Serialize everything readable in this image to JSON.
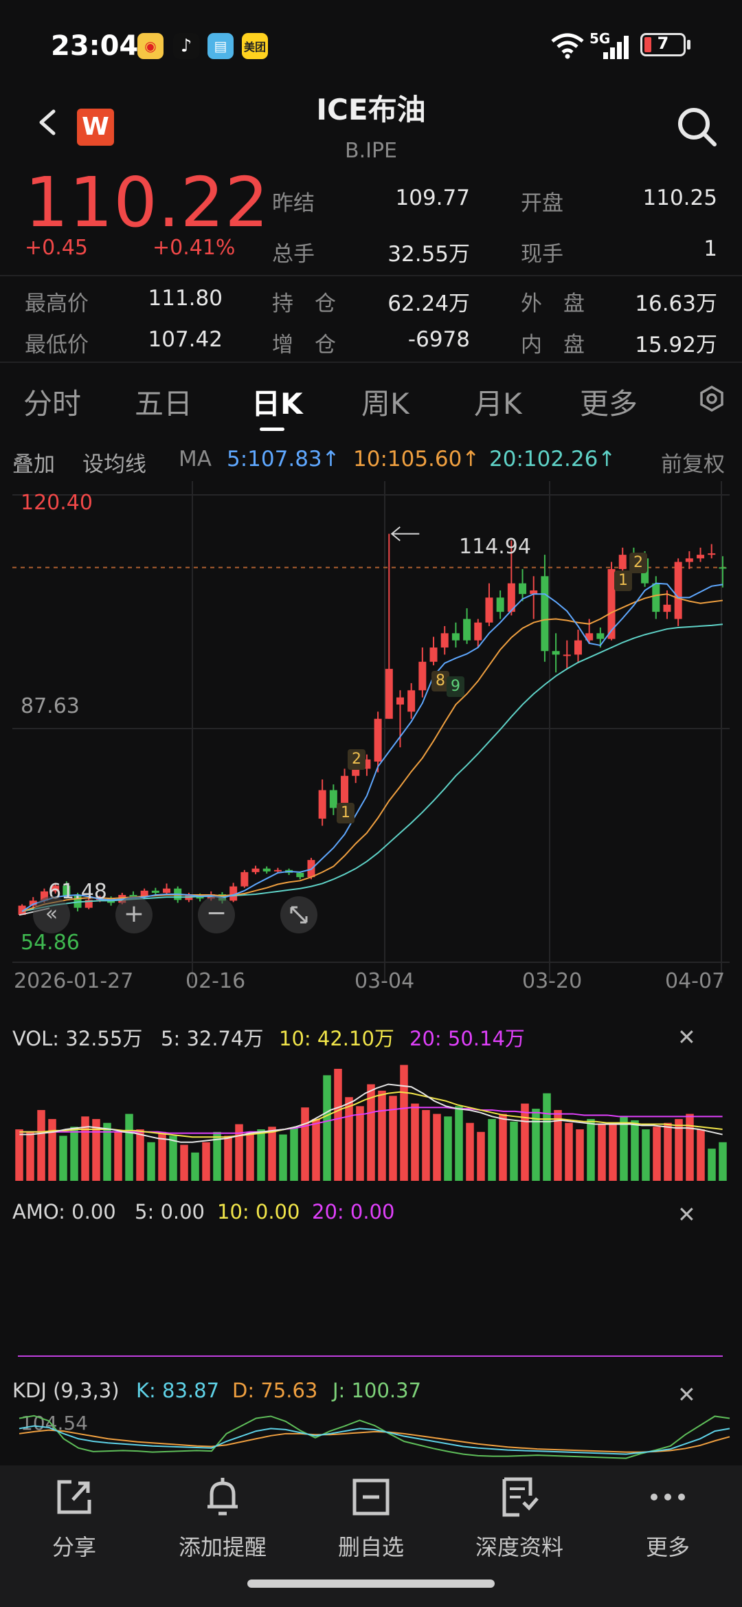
{
  "status": {
    "time": "23:04",
    "battery": "7",
    "network": "5G",
    "apps": [
      "weibo-icon",
      "tiktok-icon",
      "book-icon",
      "meituan-icon"
    ],
    "meituan_label": "美团"
  },
  "header": {
    "title": "ICE布油",
    "code": "B.IPE",
    "logo_letter": "W"
  },
  "quote": {
    "price": "110.22",
    "change": "+0.45",
    "change_pct": "+0.41%",
    "fields": [
      {
        "label": "昨结",
        "value": "109.77"
      },
      {
        "label": "开盘",
        "value": "110.25"
      },
      {
        "label": "总手",
        "value": "32.55万"
      },
      {
        "label": "现手",
        "value": "1"
      },
      {
        "label": "最高价",
        "value": "111.80"
      },
      {
        "label": "持　仓",
        "value": "62.24万"
      },
      {
        "label": "外　盘",
        "value": "16.63万"
      },
      {
        "label": "最低价",
        "value": "107.42"
      },
      {
        "label": "增　仓",
        "value": "-6978"
      },
      {
        "label": "内　盘",
        "value": "15.92万"
      }
    ]
  },
  "tabs": [
    {
      "label": "分时"
    },
    {
      "label": "五日"
    },
    {
      "label": "日K"
    },
    {
      "label": "周K"
    },
    {
      "label": "月K"
    },
    {
      "label": "更多"
    }
  ],
  "active_tab": "日K",
  "ma_row": {
    "overlay": "叠加",
    "set_ma": "设均线",
    "ma": "MA",
    "ma5": "5:107.83↑",
    "ma10": "10:105.60↑",
    "ma20": "20:102.26↑",
    "adjust": "前复权"
  },
  "colors": {
    "up": "#f04848",
    "down": "#3fb950",
    "ma5": "#5fa8ff",
    "ma10": "#f0a040",
    "ma20": "#5fd3c8",
    "yellow": "#f2e64a",
    "magenta": "#e040fb"
  },
  "chart_data": [
    {
      "type": "candlestick",
      "title": "",
      "y_labels": [
        "120.40",
        "87.63",
        "54.86"
      ],
      "ylim": [
        54.86,
        120.4
      ],
      "x_ticks": [
        "2026-01-27",
        "02-16",
        "03-04",
        "03-20",
        "04-07"
      ],
      "annotations": {
        "high": "114.94",
        "low": "61.48",
        "markers": [
          "1",
          "2",
          "8",
          "9",
          "1",
          "2"
        ]
      },
      "candles": [
        {
          "o": 61.5,
          "c": 62.8,
          "h": 63.0,
          "l": 61.5
        },
        {
          "o": 62.8,
          "c": 63.5,
          "h": 64.0,
          "l": 62.3
        },
        {
          "o": 63.5,
          "c": 64.8,
          "h": 65.2,
          "l": 63.2
        },
        {
          "o": 64.8,
          "c": 65.6,
          "h": 66.0,
          "l": 64.5
        },
        {
          "o": 65.6,
          "c": 64.2,
          "h": 66.2,
          "l": 63.8
        },
        {
          "o": 64.2,
          "c": 62.5,
          "h": 64.6,
          "l": 62.0
        },
        {
          "o": 62.5,
          "c": 63.6,
          "h": 64.0,
          "l": 62.3
        },
        {
          "o": 63.6,
          "c": 63.8,
          "h": 64.2,
          "l": 63.3
        },
        {
          "o": 63.8,
          "c": 63.2,
          "h": 64.1,
          "l": 62.8
        },
        {
          "o": 63.2,
          "c": 64.3,
          "h": 64.6,
          "l": 63.0
        },
        {
          "o": 64.3,
          "c": 64.0,
          "h": 64.8,
          "l": 63.7
        },
        {
          "o": 64.0,
          "c": 64.9,
          "h": 65.2,
          "l": 63.8
        },
        {
          "o": 64.9,
          "c": 64.6,
          "h": 65.3,
          "l": 64.2
        },
        {
          "o": 64.6,
          "c": 65.2,
          "h": 65.9,
          "l": 64.3
        },
        {
          "o": 65.2,
          "c": 63.6,
          "h": 65.5,
          "l": 63.2
        },
        {
          "o": 63.6,
          "c": 64.2,
          "h": 64.6,
          "l": 63.3
        },
        {
          "o": 64.2,
          "c": 63.8,
          "h": 64.5,
          "l": 63.4
        },
        {
          "o": 63.8,
          "c": 64.4,
          "h": 64.8,
          "l": 63.5
        },
        {
          "o": 64.4,
          "c": 63.5,
          "h": 64.7,
          "l": 63.1
        },
        {
          "o": 63.5,
          "c": 65.5,
          "h": 66.0,
          "l": 63.3
        },
        {
          "o": 65.5,
          "c": 67.5,
          "h": 67.8,
          "l": 65.3
        },
        {
          "o": 67.5,
          "c": 68.0,
          "h": 68.4,
          "l": 67.2
        },
        {
          "o": 68.0,
          "c": 67.6,
          "h": 68.3,
          "l": 67.3
        },
        {
          "o": 67.6,
          "c": 67.8,
          "h": 68.1,
          "l": 67.4
        },
        {
          "o": 67.8,
          "c": 67.4,
          "h": 68.0,
          "l": 67.1
        },
        {
          "o": 67.4,
          "c": 66.8,
          "h": 67.6,
          "l": 66.5
        },
        {
          "o": 66.8,
          "c": 69.2,
          "h": 69.5,
          "l": 66.5
        },
        {
          "o": 75.0,
          "c": 79.0,
          "h": 80.5,
          "l": 74.0
        },
        {
          "o": 79.0,
          "c": 76.5,
          "h": 79.8,
          "l": 75.5
        },
        {
          "o": 76.5,
          "c": 81.0,
          "h": 82.0,
          "l": 76.0
        },
        {
          "o": 81.0,
          "c": 82.0,
          "h": 83.5,
          "l": 80.0
        },
        {
          "o": 82.0,
          "c": 83.3,
          "h": 84.0,
          "l": 81.0
        },
        {
          "o": 83.0,
          "c": 89.0,
          "h": 90.0,
          "l": 81.5
        },
        {
          "o": 89.0,
          "c": 96.0,
          "h": 114.94,
          "l": 89.0
        },
        {
          "o": 91.0,
          "c": 92.0,
          "h": 93.0,
          "l": 85.0
        },
        {
          "o": 90.0,
          "c": 93.0,
          "h": 94.0,
          "l": 89.0
        },
        {
          "o": 93.0,
          "c": 97.0,
          "h": 99.0,
          "l": 92.0
        },
        {
          "o": 97.0,
          "c": 99.0,
          "h": 100.5,
          "l": 96.5
        },
        {
          "o": 99.0,
          "c": 101.0,
          "h": 102.0,
          "l": 98.0
        },
        {
          "o": 101.0,
          "c": 100.0,
          "h": 102.5,
          "l": 99.0
        },
        {
          "o": 103.0,
          "c": 100.0,
          "h": 104.5,
          "l": 99.5
        },
        {
          "o": 100.0,
          "c": 102.5,
          "h": 103.0,
          "l": 99.0
        },
        {
          "o": 102.5,
          "c": 106.0,
          "h": 108.0,
          "l": 102.0
        },
        {
          "o": 106.0,
          "c": 104.0,
          "h": 107.0,
          "l": 103.0
        },
        {
          "o": 104.0,
          "c": 108.0,
          "h": 114.0,
          "l": 103.5
        },
        {
          "o": 108.0,
          "c": 106.5,
          "h": 110.0,
          "l": 105.5
        },
        {
          "o": 106.5,
          "c": 107.0,
          "h": 109.0,
          "l": 103.0
        },
        {
          "o": 109.0,
          "c": 98.5,
          "h": 112.0,
          "l": 97.0
        },
        {
          "o": 98.5,
          "c": 98.0,
          "h": 101.0,
          "l": 95.5
        },
        {
          "o": 98.0,
          "c": 98.0,
          "h": 100.0,
          "l": 96.0
        },
        {
          "o": 98.0,
          "c": 100.0,
          "h": 101.5,
          "l": 97.0
        },
        {
          "o": 100.0,
          "c": 101.0,
          "h": 103.0,
          "l": 99.5
        },
        {
          "o": 101.0,
          "c": 100.2,
          "h": 101.8,
          "l": 99.0
        },
        {
          "o": 100.2,
          "c": 110.0,
          "h": 111.0,
          "l": 100.0
        },
        {
          "o": 110.0,
          "c": 112.0,
          "h": 113.0,
          "l": 109.0
        },
        {
          "o": 112.0,
          "c": 111.5,
          "h": 113.0,
          "l": 110.5
        },
        {
          "o": 111.5,
          "c": 108.0,
          "h": 112.5,
          "l": 107.5
        },
        {
          "o": 108.0,
          "c": 104.0,
          "h": 109.0,
          "l": 103.0
        },
        {
          "o": 104.0,
          "c": 105.0,
          "h": 107.0,
          "l": 103.0
        },
        {
          "o": 103.0,
          "c": 111.0,
          "h": 111.5,
          "l": 102.0
        },
        {
          "o": 111.0,
          "c": 111.5,
          "h": 112.5,
          "l": 110.0
        },
        {
          "o": 111.5,
          "c": 112.0,
          "h": 113.0,
          "l": 111.0
        },
        {
          "o": 112.0,
          "c": 112.2,
          "h": 113.5,
          "l": 111.5
        },
        {
          "o": 110.25,
          "c": 110.22,
          "h": 111.8,
          "l": 107.42
        }
      ],
      "ma5": [
        62,
        63,
        63.5,
        64,
        64.2,
        64.3,
        64.1,
        63.7,
        63.6,
        63.7,
        63.9,
        64.0,
        64.3,
        64.4,
        64.4,
        64.3,
        64.1,
        64.2,
        63.9,
        64.3,
        64.9,
        65.8,
        66.6,
        67.4,
        67.6,
        67.5,
        67.9,
        69.4,
        70.9,
        72.8,
        75.5,
        78.2,
        82.3,
        84.4,
        86.5,
        88.6,
        91.2,
        95.0,
        96.8,
        97.5,
        98.1,
        99.0,
        101.0,
        102.5,
        104.2,
        105.8,
        106.5,
        106.5,
        105.4,
        104.1,
        102.0,
        99.6,
        99.3,
        101.4,
        103.1,
        104.9,
        107.0,
        108.0,
        107.9,
        106.0,
        106.0,
        106.8,
        107.6,
        107.83
      ],
      "ma10": [
        62,
        62.5,
        63,
        63.3,
        63.6,
        63.8,
        63.9,
        63.9,
        63.8,
        63.9,
        64.0,
        64.1,
        64.2,
        64.3,
        64.3,
        64.3,
        64.3,
        64.3,
        64.2,
        64.3,
        64.5,
        64.9,
        65.3,
        65.8,
        66.1,
        66.3,
        66.8,
        67.5,
        68.3,
        69.8,
        71.5,
        73.0,
        75.1,
        77.5,
        79.5,
        81.6,
        83.5,
        85.9,
        88.5,
        91.0,
        92.5,
        94.3,
        96.5,
        98.7,
        100.4,
        101.7,
        102.5,
        102.9,
        103.0,
        102.8,
        102.5,
        102.3,
        103.0,
        103.9,
        104.6,
        105.3,
        105.9,
        106.3,
        106.5,
        105.9,
        105.5,
        105.2,
        105.4,
        105.6
      ],
      "ma20": [
        62,
        62.3,
        62.6,
        62.9,
        63.1,
        63.3,
        63.4,
        63.5,
        63.5,
        63.6,
        63.7,
        63.8,
        63.9,
        64.0,
        64.0,
        64.0,
        64.1,
        64.1,
        64.1,
        64.2,
        64.3,
        64.4,
        64.6,
        64.8,
        65.0,
        65.2,
        65.5,
        65.9,
        66.5,
        67.2,
        68.0,
        69.0,
        70.2,
        71.6,
        73.0,
        74.4,
        75.9,
        77.5,
        79.2,
        81.0,
        82.5,
        84.1,
        85.8,
        87.5,
        89.3,
        91.0,
        92.5,
        93.8,
        95.0,
        96.0,
        96.9,
        97.6,
        98.3,
        99.0,
        99.7,
        100.3,
        100.8,
        101.2,
        101.6,
        101.8,
        101.9,
        102.0,
        102.1,
        102.26
      ]
    },
    {
      "type": "bar",
      "title": "",
      "legend": {
        "vol": "VOL: 32.55万",
        "ma5": "5: 32.74万",
        "ma10": "10: 42.10万",
        "ma20": "20: 50.14万"
      },
      "values": [
        40,
        38,
        55,
        48,
        35,
        42,
        50,
        48,
        45,
        38,
        52,
        40,
        30,
        38,
        35,
        28,
        22,
        30,
        38,
        35,
        44,
        38,
        40,
        42,
        36,
        41,
        57,
        48,
        82,
        87,
        65,
        58,
        75,
        70,
        66,
        90,
        60,
        55,
        52,
        50,
        58,
        45,
        38,
        48,
        52,
        46,
        60,
        56,
        68,
        55,
        45,
        40,
        48,
        44,
        45,
        50,
        47,
        40,
        42,
        45,
        48,
        52,
        40,
        25,
        30
      ],
      "ma5": [
        36,
        36,
        37,
        38,
        40,
        41,
        42,
        41,
        40,
        38,
        37,
        35,
        33,
        32,
        30,
        30,
        31,
        32,
        33,
        35,
        37,
        38,
        39,
        40,
        42,
        45,
        50,
        55,
        58,
        62,
        68,
        72,
        75,
        74,
        73,
        68,
        62,
        58,
        56,
        55,
        53,
        50,
        48,
        47,
        46,
        46,
        46,
        47,
        46,
        45,
        44,
        44,
        44,
        44,
        43,
        43,
        42,
        41,
        41,
        40,
        38,
        36
      ],
      "ma10": [
        38,
        38,
        38,
        39,
        39,
        40,
        40,
        40,
        40,
        39,
        39,
        38,
        37,
        36,
        35,
        34,
        34,
        34,
        34,
        35,
        36,
        37,
        38,
        40,
        42,
        45,
        48,
        52,
        56,
        59,
        63,
        66,
        68,
        69,
        68,
        66,
        64,
        62,
        59,
        57,
        55,
        53,
        51,
        50,
        49,
        48,
        48,
        48,
        47,
        46,
        46,
        45,
        45,
        45,
        44,
        44,
        44,
        43,
        43,
        42,
        41,
        40
      ],
      "ma20": [
        38,
        38,
        38,
        38,
        38,
        38,
        38,
        38,
        38,
        38,
        38,
        38,
        38,
        37,
        37,
        37,
        37,
        37,
        37,
        37,
        38,
        38,
        39,
        40,
        41,
        43,
        45,
        47,
        49,
        51,
        52,
        54,
        55,
        56,
        57,
        57,
        57,
        57,
        56,
        56,
        55,
        55,
        54,
        54,
        53,
        53,
        52,
        52,
        52,
        51,
        51,
        51,
        50,
        50,
        50,
        50,
        50,
        50,
        50,
        50,
        50,
        50
      ]
    },
    {
      "type": "line",
      "title": "",
      "legend": {
        "amo": "AMO: 0.00",
        "ma5": "5: 0.00",
        "ma10": "10: 0.00",
        "ma20": "20: 0.00"
      }
    },
    {
      "type": "line",
      "title": "",
      "legend": {
        "name": "KDJ (9,3,3)",
        "k": "K: 83.87",
        "d": "D: 75.63",
        "j": "J: 100.37"
      },
      "y_labels": [
        "104.54"
      ],
      "k": [
        80,
        85,
        82,
        70,
        60,
        55,
        52,
        50,
        48,
        46,
        45,
        44,
        43,
        42,
        55,
        65,
        75,
        80,
        78,
        72,
        66,
        70,
        75,
        80,
        78,
        72,
        65,
        60,
        55,
        50,
        45,
        42,
        40,
        38,
        37,
        36,
        35,
        34,
        33,
        32,
        31,
        30,
        33,
        36,
        40,
        50,
        60,
        75,
        80
      ],
      "d": [
        70,
        74,
        77,
        75,
        70,
        65,
        60,
        57,
        54,
        52,
        50,
        48,
        46,
        45,
        48,
        54,
        60,
        66,
        70,
        70,
        68,
        68,
        70,
        72,
        74,
        73,
        70,
        66,
        62,
        58,
        54,
        50,
        47,
        44,
        42,
        40,
        39,
        38,
        37,
        36,
        35,
        34,
        34,
        35,
        37,
        41,
        47,
        56,
        64
      ],
      "j": [
        100,
        105,
        95,
        60,
        42,
        35,
        36,
        37,
        36,
        34,
        35,
        36,
        37,
        36,
        70,
        85,
        100,
        104,
        94,
        76,
        62,
        75,
        85,
        96,
        86,
        70,
        55,
        48,
        41,
        35,
        30,
        27,
        26,
        26,
        27,
        28,
        27,
        26,
        25,
        24,
        23,
        22,
        31,
        38,
        46,
        68,
        86,
        104,
        100
      ]
    }
  ],
  "bottom_bar": [
    {
      "icon": "share-icon",
      "label": "分享"
    },
    {
      "icon": "bell-icon",
      "label": "添加提醒"
    },
    {
      "icon": "remove-watchlist-icon",
      "label": "删自选"
    },
    {
      "icon": "research-doc-icon",
      "label": "深度资料"
    },
    {
      "icon": "more-icon",
      "label": "更多"
    }
  ]
}
